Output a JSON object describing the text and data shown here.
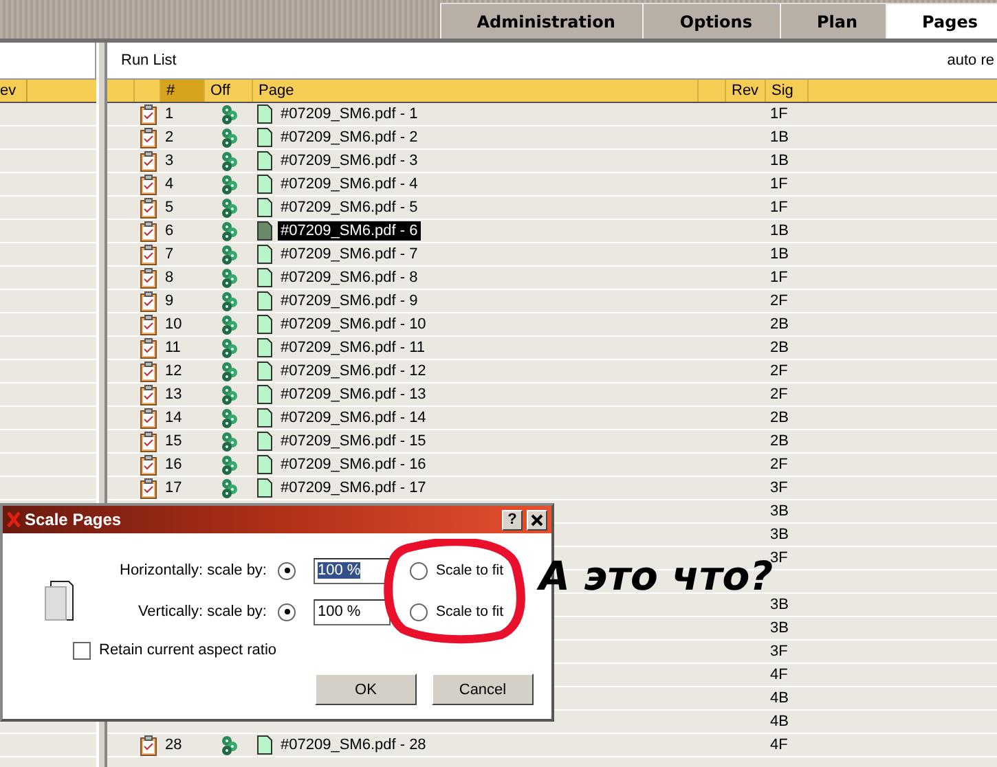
{
  "tabs": [
    {
      "label": "Administration",
      "selected": false
    },
    {
      "label": "Options",
      "selected": false
    },
    {
      "label": "Plan",
      "selected": false
    },
    {
      "label": "Pages",
      "selected": true
    }
  ],
  "left_panel": {
    "columns": [
      "ev"
    ]
  },
  "run_list": {
    "title": "Run List",
    "right_label": "auto re",
    "columns": [
      "#",
      "Off",
      "Page",
      "Rev",
      "Sig"
    ],
    "rows": [
      {
        "kind": "page",
        "number": "1",
        "page": "#07209_SM6.pdf - 1",
        "sig": "1F",
        "selected": false
      },
      {
        "kind": "page",
        "number": "2",
        "page": "#07209_SM6.pdf - 2",
        "sig": "1B",
        "selected": false
      },
      {
        "kind": "page",
        "number": "3",
        "page": "#07209_SM6.pdf - 3",
        "sig": "1B",
        "selected": false
      },
      {
        "kind": "page",
        "number": "4",
        "page": "#07209_SM6.pdf - 4",
        "sig": "1F",
        "selected": false
      },
      {
        "kind": "page",
        "number": "5",
        "page": "#07209_SM6.pdf - 5",
        "sig": "1F",
        "selected": false
      },
      {
        "kind": "page",
        "number": "6",
        "page": "#07209_SM6.pdf - 6",
        "sig": "1B",
        "selected": true
      },
      {
        "kind": "page",
        "number": "7",
        "page": "#07209_SM6.pdf - 7",
        "sig": "1B",
        "selected": false
      },
      {
        "kind": "page",
        "number": "8",
        "page": "#07209_SM6.pdf - 8",
        "sig": "1F",
        "selected": false
      },
      {
        "kind": "page",
        "number": "9",
        "page": "#07209_SM6.pdf - 9",
        "sig": "2F",
        "selected": false
      },
      {
        "kind": "page",
        "number": "10",
        "page": "#07209_SM6.pdf - 10",
        "sig": "2B",
        "selected": false
      },
      {
        "kind": "page",
        "number": "11",
        "page": "#07209_SM6.pdf - 11",
        "sig": "2B",
        "selected": false
      },
      {
        "kind": "page",
        "number": "12",
        "page": "#07209_SM6.pdf - 12",
        "sig": "2F",
        "selected": false
      },
      {
        "kind": "page",
        "number": "13",
        "page": "#07209_SM6.pdf - 13",
        "sig": "2F",
        "selected": false
      },
      {
        "kind": "page",
        "number": "14",
        "page": "#07209_SM6.pdf - 14",
        "sig": "2B",
        "selected": false
      },
      {
        "kind": "page",
        "number": "15",
        "page": "#07209_SM6.pdf - 15",
        "sig": "2B",
        "selected": false
      },
      {
        "kind": "page",
        "number": "16",
        "page": "#07209_SM6.pdf - 16",
        "sig": "2F",
        "selected": false
      },
      {
        "kind": "page",
        "number": "17",
        "page": "#07209_SM6.pdf - 17",
        "sig": "3F",
        "selected": false
      },
      {
        "kind": "covered",
        "sig": "3B"
      },
      {
        "kind": "covered",
        "sig": "3B"
      },
      {
        "kind": "covered",
        "sig": "3F"
      },
      {
        "kind": "covered"
      },
      {
        "kind": "covered",
        "sig": "3B"
      },
      {
        "kind": "covered",
        "sig": "3B"
      },
      {
        "kind": "covered",
        "sig": "3F"
      },
      {
        "kind": "covered",
        "sig": "4F"
      },
      {
        "kind": "covered",
        "sig": "4B"
      },
      {
        "kind": "covered",
        "sig": "4B"
      },
      {
        "kind": "page",
        "number": "28",
        "page": "#07209_SM6.pdf - 28",
        "sig": "4F",
        "selected": false
      }
    ]
  },
  "dialog": {
    "title": "Scale Pages",
    "help": "?",
    "scale_rows": [
      {
        "label": "Horizontally: scale by:",
        "scale_by_selected": true,
        "value": "100 %",
        "value_highlighted": true,
        "fit_label": "Scale to fit",
        "fit_selected": false
      },
      {
        "label": "Vertically: scale by:",
        "scale_by_selected": true,
        "value": "100 %",
        "value_highlighted": false,
        "fit_label": "Scale to fit",
        "fit_selected": false
      }
    ],
    "retain": {
      "label": "Retain current aspect ratio",
      "checked": false
    },
    "buttons": [
      "OK",
      "Cancel"
    ]
  },
  "annotation": {
    "text": "А это что?"
  }
}
